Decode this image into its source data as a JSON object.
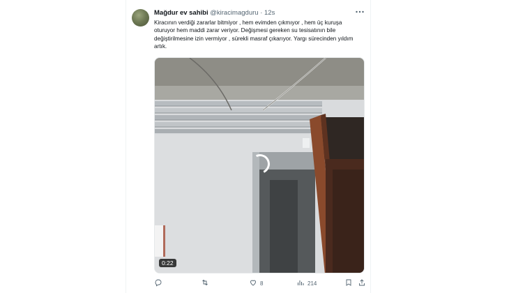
{
  "tweet": {
    "author_name": "Mağdur ev sahibi",
    "author_handle": "@kiracimagduru",
    "separator": "·",
    "time": "12s",
    "text": "Kiracının verdiği zararlar bitmiyor , hem evimden çıkmıyor , hem üç kuruşa oturuyor hem maddi zarar veriyor. Değişmesi gereken su tesisatının bile değiştirilmesine izin vermiyor , sürekli masraf çıkarıyor. Yargı sürecinden yıldım artık."
  },
  "video": {
    "duration": "0:22"
  },
  "actions": {
    "reply_count": "",
    "retweet_count": "",
    "like_count": "8",
    "view_count": "214"
  },
  "icons": {
    "more": "more-horizontal-icon",
    "reply": "reply-icon",
    "retweet": "retweet-icon",
    "like": "heart-icon",
    "views": "views-bar-chart-icon",
    "bookmark": "bookmark-icon",
    "share": "share-icon"
  },
  "colors": {
    "text_primary": "#0f1419",
    "text_secondary": "#536471",
    "border": "#eff3f4"
  }
}
